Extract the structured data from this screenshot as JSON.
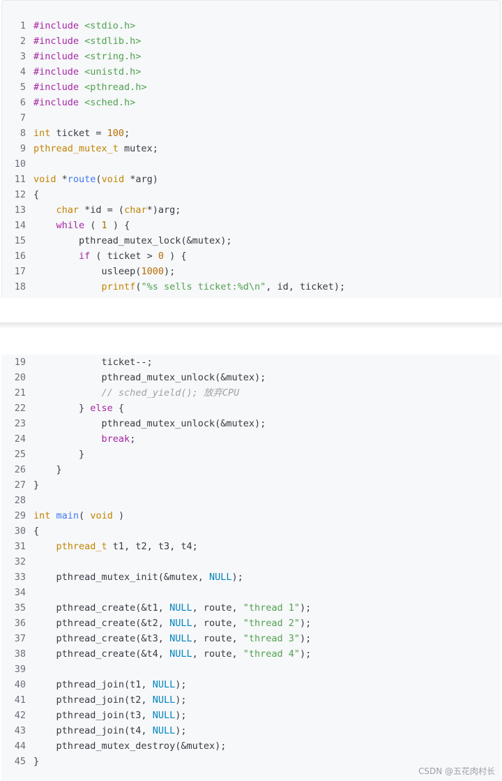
{
  "code": {
    "part1": [
      {
        "n": "1",
        "t": [
          {
            "c": "kw",
            "s": "#include "
          },
          {
            "c": "str",
            "s": "<stdio.h>"
          }
        ]
      },
      {
        "n": "2",
        "t": [
          {
            "c": "kw",
            "s": "#include "
          },
          {
            "c": "str",
            "s": "<stdlib.h>"
          }
        ]
      },
      {
        "n": "3",
        "t": [
          {
            "c": "kw",
            "s": "#include "
          },
          {
            "c": "str",
            "s": "<string.h>"
          }
        ]
      },
      {
        "n": "4",
        "t": [
          {
            "c": "kw",
            "s": "#include "
          },
          {
            "c": "str",
            "s": "<unistd.h>"
          }
        ]
      },
      {
        "n": "5",
        "t": [
          {
            "c": "kw",
            "s": "#include "
          },
          {
            "c": "str",
            "s": "<pthread.h>"
          }
        ]
      },
      {
        "n": "6",
        "t": [
          {
            "c": "kw",
            "s": "#include "
          },
          {
            "c": "str",
            "s": "<sched.h>"
          }
        ]
      },
      {
        "n": "7",
        "t": []
      },
      {
        "n": "8",
        "t": [
          {
            "c": "ty",
            "s": "int"
          },
          {
            "c": "",
            "s": " ticket = "
          },
          {
            "c": "num",
            "s": "100"
          },
          {
            "c": "",
            "s": ";"
          }
        ]
      },
      {
        "n": "9",
        "t": [
          {
            "c": "ty",
            "s": "pthread_mutex_t"
          },
          {
            "c": "",
            "s": " mutex;"
          }
        ]
      },
      {
        "n": "10",
        "t": []
      },
      {
        "n": "11",
        "t": [
          {
            "c": "ty",
            "s": "void"
          },
          {
            "c": "",
            "s": " *"
          },
          {
            "c": "fn",
            "s": "route"
          },
          {
            "c": "",
            "s": "("
          },
          {
            "c": "ty",
            "s": "void"
          },
          {
            "c": "",
            "s": " *arg)"
          }
        ]
      },
      {
        "n": "12",
        "t": [
          {
            "c": "",
            "s": "{"
          }
        ]
      },
      {
        "n": "13",
        "t": [
          {
            "c": "",
            "s": "    "
          },
          {
            "c": "ty",
            "s": "char"
          },
          {
            "c": "",
            "s": " *id = ("
          },
          {
            "c": "ty",
            "s": "char"
          },
          {
            "c": "",
            "s": "*)arg;"
          }
        ]
      },
      {
        "n": "14",
        "t": [
          {
            "c": "",
            "s": "    "
          },
          {
            "c": "kw",
            "s": "while"
          },
          {
            "c": "",
            "s": " ( "
          },
          {
            "c": "num",
            "s": "1"
          },
          {
            "c": "",
            "s": " ) {"
          }
        ]
      },
      {
        "n": "15",
        "t": [
          {
            "c": "",
            "s": "        pthread_mutex_lock(&mutex);"
          }
        ]
      },
      {
        "n": "16",
        "t": [
          {
            "c": "",
            "s": "        "
          },
          {
            "c": "kw",
            "s": "if"
          },
          {
            "c": "",
            "s": " ( ticket > "
          },
          {
            "c": "num",
            "s": "0"
          },
          {
            "c": "",
            "s": " ) {"
          }
        ]
      },
      {
        "n": "17",
        "t": [
          {
            "c": "",
            "s": "            usleep("
          },
          {
            "c": "num",
            "s": "1000"
          },
          {
            "c": "",
            "s": ");"
          }
        ]
      },
      {
        "n": "18",
        "t": [
          {
            "c": "",
            "s": "            "
          },
          {
            "c": "ty",
            "s": "printf"
          },
          {
            "c": "",
            "s": "("
          },
          {
            "c": "str",
            "s": "\"%s sells ticket:%d\\n\""
          },
          {
            "c": "",
            "s": ", id, ticket);"
          }
        ]
      }
    ],
    "part2": [
      {
        "n": "19",
        "t": [
          {
            "c": "",
            "s": "            ticket--;"
          }
        ]
      },
      {
        "n": "20",
        "t": [
          {
            "c": "",
            "s": "            pthread_mutex_unlock(&mutex);"
          }
        ]
      },
      {
        "n": "21",
        "t": [
          {
            "c": "",
            "s": "            "
          },
          {
            "c": "cm",
            "s": "// sched_yield(); 放弃CPU"
          }
        ]
      },
      {
        "n": "22",
        "t": [
          {
            "c": "",
            "s": "        } "
          },
          {
            "c": "kw",
            "s": "else"
          },
          {
            "c": "",
            "s": " {"
          }
        ]
      },
      {
        "n": "23",
        "t": [
          {
            "c": "",
            "s": "            pthread_mutex_unlock(&mutex);"
          }
        ]
      },
      {
        "n": "24",
        "t": [
          {
            "c": "",
            "s": "            "
          },
          {
            "c": "kw",
            "s": "break"
          },
          {
            "c": "",
            "s": ";"
          }
        ]
      },
      {
        "n": "25",
        "t": [
          {
            "c": "",
            "s": "        }"
          }
        ]
      },
      {
        "n": "26",
        "t": [
          {
            "c": "",
            "s": "    }"
          }
        ]
      },
      {
        "n": "27",
        "t": [
          {
            "c": "",
            "s": "}"
          }
        ]
      },
      {
        "n": "28",
        "t": []
      },
      {
        "n": "29",
        "t": [
          {
            "c": "ty",
            "s": "int"
          },
          {
            "c": "",
            "s": " "
          },
          {
            "c": "fn",
            "s": "main"
          },
          {
            "c": "",
            "s": "( "
          },
          {
            "c": "ty",
            "s": "void"
          },
          {
            "c": "",
            "s": " )"
          }
        ]
      },
      {
        "n": "30",
        "t": [
          {
            "c": "",
            "s": "{"
          }
        ]
      },
      {
        "n": "31",
        "t": [
          {
            "c": "",
            "s": "    "
          },
          {
            "c": "ty",
            "s": "pthread_t"
          },
          {
            "c": "",
            "s": " t1, t2, t3, t4;"
          }
        ]
      },
      {
        "n": "32",
        "t": []
      },
      {
        "n": "33",
        "t": [
          {
            "c": "",
            "s": "    pthread_mutex_init(&mutex, "
          },
          {
            "c": "lit",
            "s": "NULL"
          },
          {
            "c": "",
            "s": ");"
          }
        ]
      },
      {
        "n": "34",
        "t": []
      },
      {
        "n": "35",
        "t": [
          {
            "c": "",
            "s": "    pthread_create(&t1, "
          },
          {
            "c": "lit",
            "s": "NULL"
          },
          {
            "c": "",
            "s": ", route, "
          },
          {
            "c": "str",
            "s": "\"thread 1\""
          },
          {
            "c": "",
            "s": ");"
          }
        ]
      },
      {
        "n": "36",
        "t": [
          {
            "c": "",
            "s": "    pthread_create(&t2, "
          },
          {
            "c": "lit",
            "s": "NULL"
          },
          {
            "c": "",
            "s": ", route, "
          },
          {
            "c": "str",
            "s": "\"thread 2\""
          },
          {
            "c": "",
            "s": ");"
          }
        ]
      },
      {
        "n": "37",
        "t": [
          {
            "c": "",
            "s": "    pthread_create(&t3, "
          },
          {
            "c": "lit",
            "s": "NULL"
          },
          {
            "c": "",
            "s": ", route, "
          },
          {
            "c": "str",
            "s": "\"thread 3\""
          },
          {
            "c": "",
            "s": ");"
          }
        ]
      },
      {
        "n": "38",
        "t": [
          {
            "c": "",
            "s": "    pthread_create(&t4, "
          },
          {
            "c": "lit",
            "s": "NULL"
          },
          {
            "c": "",
            "s": ", route, "
          },
          {
            "c": "str",
            "s": "\"thread 4\""
          },
          {
            "c": "",
            "s": ");"
          }
        ]
      },
      {
        "n": "39",
        "t": []
      },
      {
        "n": "40",
        "t": [
          {
            "c": "",
            "s": "    pthread_join(t1, "
          },
          {
            "c": "lit",
            "s": "NULL"
          },
          {
            "c": "",
            "s": ");"
          }
        ]
      },
      {
        "n": "41",
        "t": [
          {
            "c": "",
            "s": "    pthread_join(t2, "
          },
          {
            "c": "lit",
            "s": "NULL"
          },
          {
            "c": "",
            "s": ");"
          }
        ]
      },
      {
        "n": "42",
        "t": [
          {
            "c": "",
            "s": "    pthread_join(t3, "
          },
          {
            "c": "lit",
            "s": "NULL"
          },
          {
            "c": "",
            "s": ");"
          }
        ]
      },
      {
        "n": "43",
        "t": [
          {
            "c": "",
            "s": "    pthread_join(t4, "
          },
          {
            "c": "lit",
            "s": "NULL"
          },
          {
            "c": "",
            "s": ");"
          }
        ]
      },
      {
        "n": "44",
        "t": [
          {
            "c": "",
            "s": "    pthread_mutex_destroy(&mutex);"
          }
        ]
      },
      {
        "n": "45",
        "t": [
          {
            "c": "",
            "s": "}"
          }
        ]
      }
    ]
  },
  "watermark": "CSDN @五花肉村长"
}
